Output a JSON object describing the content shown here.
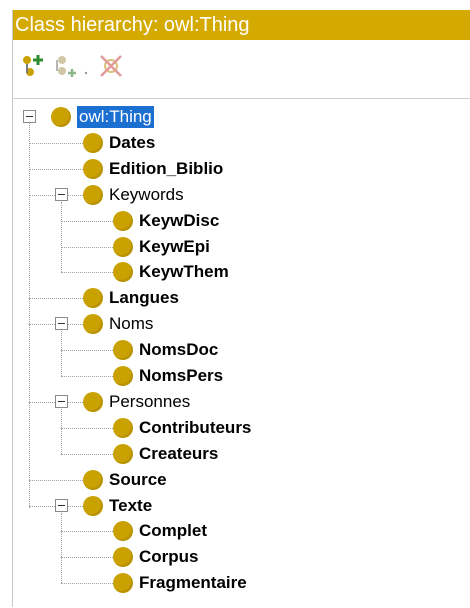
{
  "panel": {
    "title": "Class hierarchy: owl:Thing"
  },
  "toolbar": {
    "add_subclass_icon": "add-subclass-icon",
    "add_sibling_icon": "add-sibling-icon",
    "delete_class_icon": "delete-class-icon"
  },
  "colors": {
    "title_bg": "#d4aa00",
    "class_dot": "#c9a100",
    "selection": "#1a6fd1"
  },
  "tree": {
    "root": {
      "label": "owl:Thing",
      "selected": true,
      "expanded": true
    },
    "items": [
      {
        "label": "Dates",
        "depth": 1,
        "bold": true,
        "expandable": false
      },
      {
        "label": "Edition_Biblio",
        "depth": 1,
        "bold": true,
        "expandable": false
      },
      {
        "label": "Keywords",
        "depth": 1,
        "bold": false,
        "expandable": true,
        "expanded": true
      },
      {
        "label": "KeywDisc",
        "depth": 2,
        "bold": true,
        "expandable": false
      },
      {
        "label": "KeywEpi",
        "depth": 2,
        "bold": true,
        "expandable": false
      },
      {
        "label": "KeywThem",
        "depth": 2,
        "bold": true,
        "expandable": false
      },
      {
        "label": "Langues",
        "depth": 1,
        "bold": true,
        "expandable": false
      },
      {
        "label": "Noms",
        "depth": 1,
        "bold": false,
        "expandable": true,
        "expanded": true
      },
      {
        "label": "NomsDoc",
        "depth": 2,
        "bold": true,
        "expandable": false
      },
      {
        "label": "NomsPers",
        "depth": 2,
        "bold": true,
        "expandable": false
      },
      {
        "label": "Personnes",
        "depth": 1,
        "bold": false,
        "expandable": true,
        "expanded": true
      },
      {
        "label": "Contributeurs",
        "depth": 2,
        "bold": true,
        "expandable": false
      },
      {
        "label": "Createurs",
        "depth": 2,
        "bold": true,
        "expandable": false
      },
      {
        "label": "Source",
        "depth": 1,
        "bold": true,
        "expandable": false
      },
      {
        "label": "Texte",
        "depth": 1,
        "bold": true,
        "expandable": true,
        "expanded": true
      },
      {
        "label": "Complet",
        "depth": 2,
        "bold": true,
        "expandable": false
      },
      {
        "label": "Corpus",
        "depth": 2,
        "bold": true,
        "expandable": false
      },
      {
        "label": "Fragmentaire",
        "depth": 2,
        "bold": true,
        "expandable": false
      }
    ]
  }
}
